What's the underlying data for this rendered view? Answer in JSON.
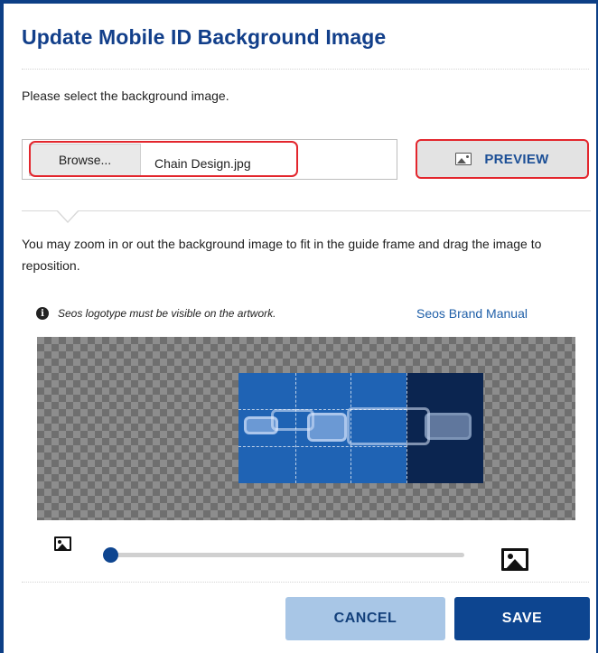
{
  "dialog": {
    "title": "Update Mobile ID Background Image",
    "instruction": "Please select the background image."
  },
  "file_picker": {
    "browse_label": "Browse...",
    "file_name": "Chain Design.jpg"
  },
  "preview": {
    "label": "PREVIEW",
    "icon": "image-icon"
  },
  "zoom_instruction": "You may zoom in or out the background image to fit in the guide frame and drag the image to reposition.",
  "notice": {
    "icon": "info-icon",
    "text": "Seos logotype must be visible on the artwork.",
    "link_text": "Seos Brand Manual"
  },
  "zoom": {
    "min_icon": "small-image-icon",
    "max_icon": "large-image-icon",
    "level": 0
  },
  "actions": {
    "cancel_label": "CANCEL",
    "save_label": "SAVE"
  },
  "colors": {
    "brand": "#123f8a",
    "accent": "#0d4590",
    "highlight": "#e3262d",
    "cancel_bg": "#a8c6e6"
  }
}
